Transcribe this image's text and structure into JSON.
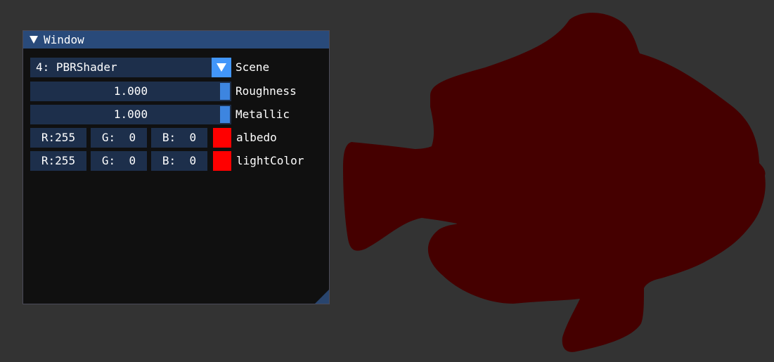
{
  "window": {
    "title": "Window"
  },
  "scene": {
    "selected": "4: PBRShader",
    "label": "Scene"
  },
  "roughness": {
    "value_text": "1.000",
    "value": 1.0,
    "label": "Roughness"
  },
  "metallic": {
    "value_text": "1.000",
    "value": 1.0,
    "label": "Metallic"
  },
  "albedo": {
    "r": "R:255",
    "g": "G:  0",
    "b": "B:  0",
    "swatch_color": "#ff0000",
    "label": "albedo"
  },
  "light_color": {
    "r": "R:255",
    "g": "G:  0",
    "b": "B:  0",
    "swatch_color": "#ff0000",
    "label": "lightColor"
  },
  "viewport": {
    "background_color": "#333333",
    "model_color": "#450000",
    "model_icon": "fish-silhouette-icon"
  }
}
